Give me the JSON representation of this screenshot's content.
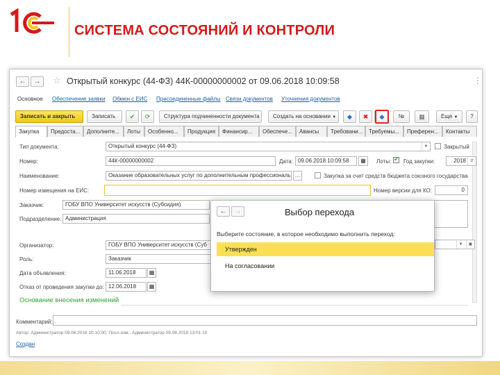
{
  "slide": {
    "title": "СИСТЕМА СОСТОЯНИЙ И КОНТРОЛИ",
    "logo_colors": {
      "red": "#d6191b",
      "yellow": "#f2c81a"
    }
  },
  "window": {
    "title": "Открытый конкурс (44-ФЗ) 44К-00000000002 от 09.06.2018 10:09:58",
    "menu_icon": "more-vertical-icon",
    "back_icon": "arrow-left-icon",
    "forward_icon": "arrow-right-icon",
    "star_icon": "star-icon",
    "links": [
      "Основное",
      "Обеспечение заявки",
      "Обмен с ЕИС",
      "Присоединенные файлы",
      "Связи документов",
      "Уточнения документов"
    ],
    "toolbar": {
      "save_close": "Записать и закрыть",
      "save": "Записать",
      "structure": "Структура подчиненности документа",
      "create_based": "Создать на основании",
      "number_btn": "№",
      "more": "Еще",
      "help": "?"
    },
    "tabs": [
      "Закупка",
      "Предоста...",
      "Дополните...",
      "Лоты",
      "Особенно...",
      "Продукция",
      "Финансир...",
      "Обеспече...",
      "Авансы",
      "Требовани...",
      "Требуемы...",
      "Преферен...",
      "Контакты"
    ],
    "form": {
      "doc_type_label": "Тип документа:",
      "doc_type_value": "Открытый конкурс (44-ФЗ)",
      "closed_label": "Закрытый",
      "number_label": "Номер:",
      "number_value": "44К-00000000002",
      "date_label": "Дата:",
      "date_value": "09.06.2018 10:09:58",
      "lots_label": "Лоты:",
      "year_label": "Год закупки:",
      "year_value": "2018",
      "name_label": "Наименование:",
      "name_value": "Оказание образовательных услуг по дополнительным профессиональн",
      "federal_label": "Закупка за счет средств бюджета союзного государства",
      "eis_label": "Номер извещения на ЕИС:",
      "eis_value": "",
      "version_label": "Номер версии для КО:",
      "version_value": "0",
      "customer_label": "Заказчик:",
      "customer_value": "ГОБУ ВПО Университет искусств (Субсидия)",
      "division_label": "Подразделение:",
      "division_value": "Администрация",
      "organizer_label": "Организатор:",
      "organizer_value": "ГОБУ ВПО Университет искусств (Суб",
      "role_label": "Роль:",
      "role_value": "Заказчик",
      "pub_date_label": "Дата объявления:",
      "pub_date_value": "11.06.2018",
      "refuse_label": "Отказ от проведения закупки до:",
      "refuse_value": "12.06.2018",
      "changes_header": "Основание внесения изменений",
      "comment_label": "Комментарий:",
      "comment_value": "",
      "author_line": "Автор: Администратор 09.06.2018 10:10:00,  Посл.изм.: Администратор 09.06.2018 13:01:10",
      "status_link": "Создан"
    }
  },
  "dialog": {
    "title": "Выбор перехода",
    "prompt": "Выберите состояние, в которое необходимо выполнить переход:",
    "options": [
      "Утвержден",
      "На согласовании"
    ],
    "selected_index": 0,
    "selection_color": "#fadf54"
  }
}
